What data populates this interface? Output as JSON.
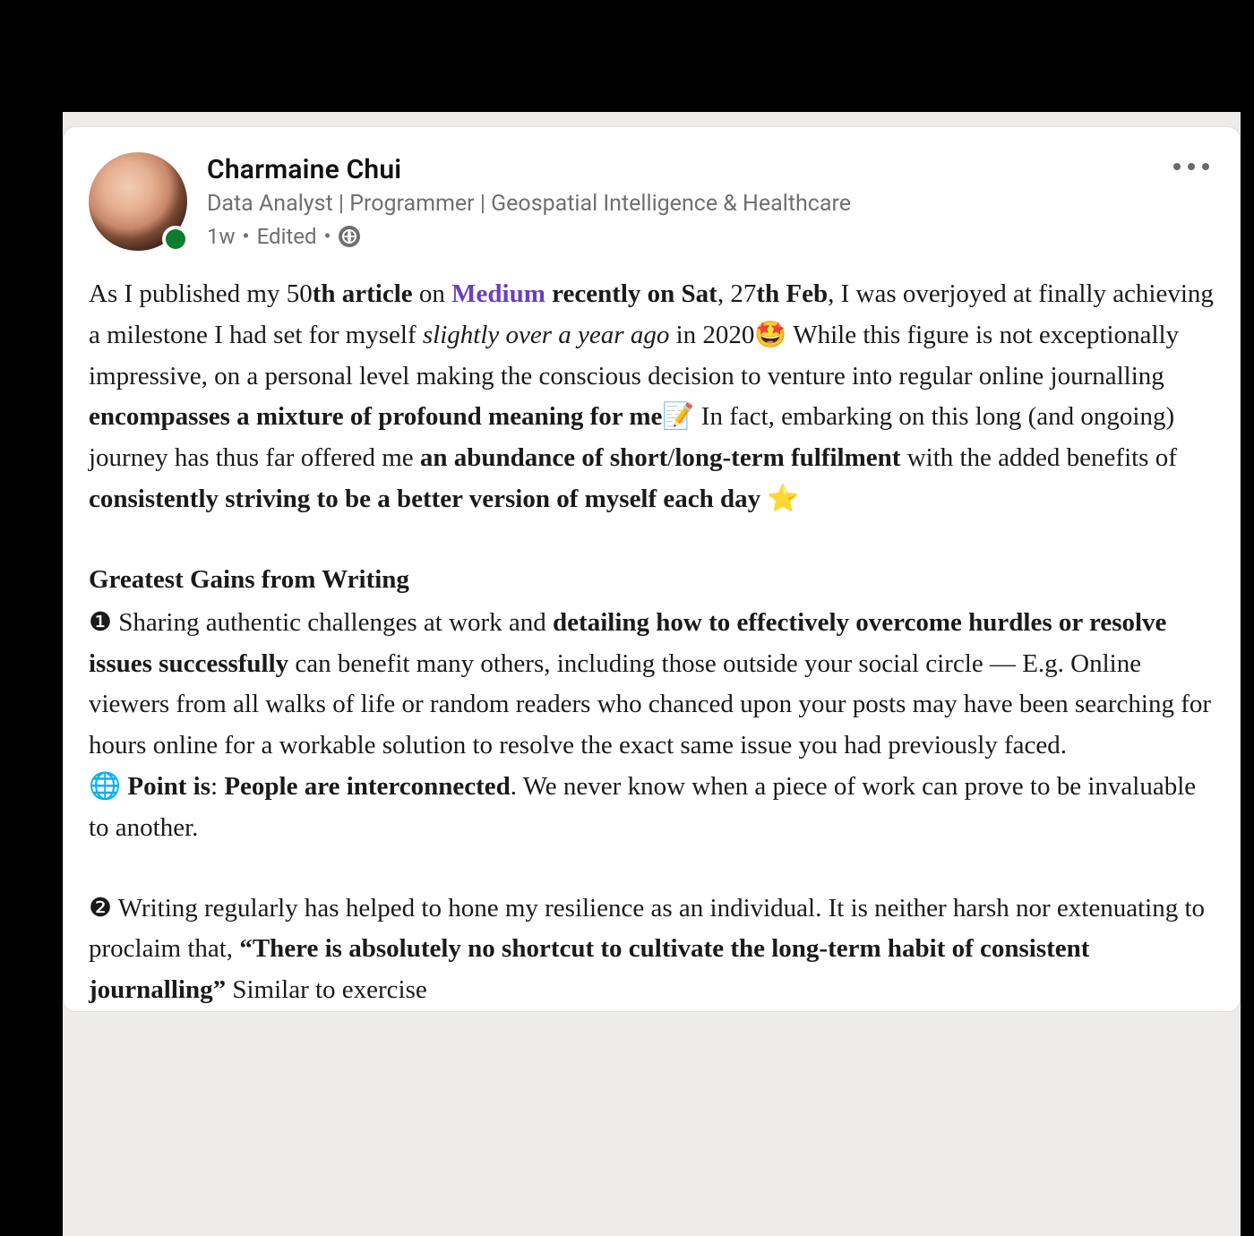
{
  "author": {
    "name": "Charmaine Chui",
    "headline": "Data Analyst | Programmer | Geospatial Intelligence & Healthcare",
    "time": "1w",
    "edited": "Edited",
    "visibility": "public"
  },
  "post": {
    "p1_pre": "As I published my 50",
    "p1_bold1": "th article",
    "p1_on": " on ",
    "p1_link": "Medium",
    "p1_bold2": " recently on Sat",
    "p1_mid1": ", 27",
    "p1_bold3": "th Feb",
    "p1_mid2": ", I was overjoyed at finally achieving a milestone I had set for myself ",
    "p1_em1": "slightly over a year ago",
    "p1_mid3": " in 2020",
    "p1_emoji1": "🤩",
    "p1_mid4": " While this figure is not exceptionally impressive, on a personal level making the conscious decision to venture into regular online journalling ",
    "p1_bold4": "encompasses a mixture of profound meaning for me",
    "p1_emoji2": "📝",
    "p1_mid5": " In fact, embarking on this long (and ongoing) journey has thus far offered me ",
    "p1_bold5": "an abundance of short",
    "p1_slash": "/",
    "p1_bold6": "long-term fulfilment",
    "p1_mid6": " with the added benefits of ",
    "p1_bold7": "consistently striving to be a better version of myself each day",
    "p1_space": " ",
    "p1_emoji3": "⭐",
    "p2_title": "Greatest Gains from Writing",
    "p2_num1": "❶",
    "p2_t1": " Sharing authentic challenges at work and ",
    "p2_b1": "detailing how to effectively overcome hurdles or resolve issues successfully",
    "p2_t2": " can benefit many others, including those outside your social circle — E.g. Online viewers from all walks of life or random readers who chanced upon your posts may have been searching for hours online for a workable solution to resolve the exact same issue you had previously faced.",
    "p2_globe": "🌐",
    "p2_b2": " Point is",
    "p2_colon": ": ",
    "p2_b3": "People are interconnected",
    "p2_t3": ". We never know when a piece of work can prove to be invaluable to another.",
    "p3_num2": "❷",
    "p3_t1": " Writing regularly has helped to hone my resilience as an individual. It is neither harsh nor extenuating to proclaim that, ",
    "p3_q": "“There is absolutely no shortcut to cultivate the long-term habit of consistent journalling”",
    "p3_t2": "  Similar to exercise"
  }
}
